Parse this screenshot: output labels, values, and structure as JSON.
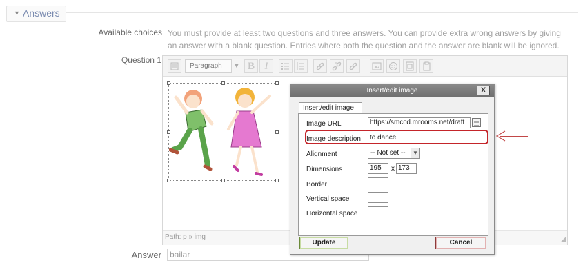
{
  "section": {
    "legend": "Answers",
    "caret": "▼"
  },
  "available_choices": {
    "label": "Available choices",
    "help_line1": "You must provide at least two questions and three answers. You can provide extra wrong answers by giving",
    "help_line2": "an answer with a blank question. Entries where both the question and the answer are blank will be ignored."
  },
  "question": {
    "label": "Question 1"
  },
  "editor": {
    "format_select": "Paragraph",
    "path": "Path: p » img",
    "toolbar_icons": [
      "html-icon",
      "paragraph-select",
      "bold-icon",
      "italic-icon",
      "bullet-list-icon",
      "numbered-list-icon",
      "link-icon",
      "unlink-icon",
      "anchor-icon",
      "image-icon",
      "emoticon-icon",
      "media-icon",
      "paste-icon"
    ]
  },
  "answer": {
    "label": "Answer",
    "value": "bailar"
  },
  "dialog": {
    "title": "Insert/edit image",
    "close": "X",
    "tab": "Insert/edit image",
    "image_url_label": "Image URL",
    "image_url_value": "https://smccd.mrooms.net/draft",
    "image_description_label": "Image description",
    "image_description_value": "to dance",
    "alignment_label": "Alignment",
    "alignment_value": "-- Not set --",
    "dimensions_label": "Dimensions",
    "width_value": "195",
    "times": "x",
    "height_value": "173",
    "border_label": "Border",
    "vertical_space_label": "Vertical space",
    "horizontal_space_label": "Horizontal space",
    "update_button": "Update",
    "cancel_button": "Cancel"
  },
  "colors": {
    "highlight": "#c4252a",
    "arrow": "#c24848",
    "legend_text": "#7a8bb0"
  }
}
